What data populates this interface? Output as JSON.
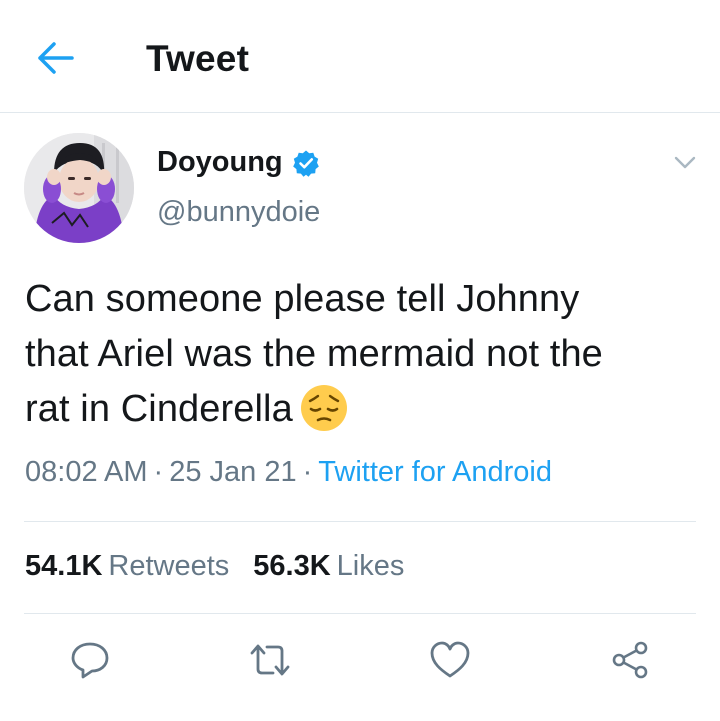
{
  "header": {
    "title": "Tweet",
    "back_icon": "arrow-left-icon"
  },
  "author": {
    "display_name": "Doyoung",
    "handle": "@bunnydoie",
    "verified_icon": "verified-badge-icon",
    "more_icon": "chevron-down-icon"
  },
  "tweet": {
    "text_lines": [
      "Can someone please tell Johnny",
      "that Ariel was the mermaid not the",
      "rat in Cinderella"
    ],
    "emoji_icon": "pensive-face-emoji-icon",
    "time": "08:02 AM",
    "date": "25 Jan 21",
    "separator": "·",
    "source": "Twitter for Android"
  },
  "stats": {
    "retweets_count": "54.1K",
    "retweets_label": "Retweets",
    "likes_count": "56.3K",
    "likes_label": "Likes"
  },
  "actions": {
    "reply_icon": "reply-icon",
    "retweet_icon": "retweet-icon",
    "like_icon": "heart-icon",
    "share_icon": "share-icon"
  },
  "colors": {
    "accent": "#1da1f2",
    "text_primary": "#14171a",
    "text_secondary": "#657786",
    "divider": "#e1e8ed",
    "icon": "#657786"
  }
}
